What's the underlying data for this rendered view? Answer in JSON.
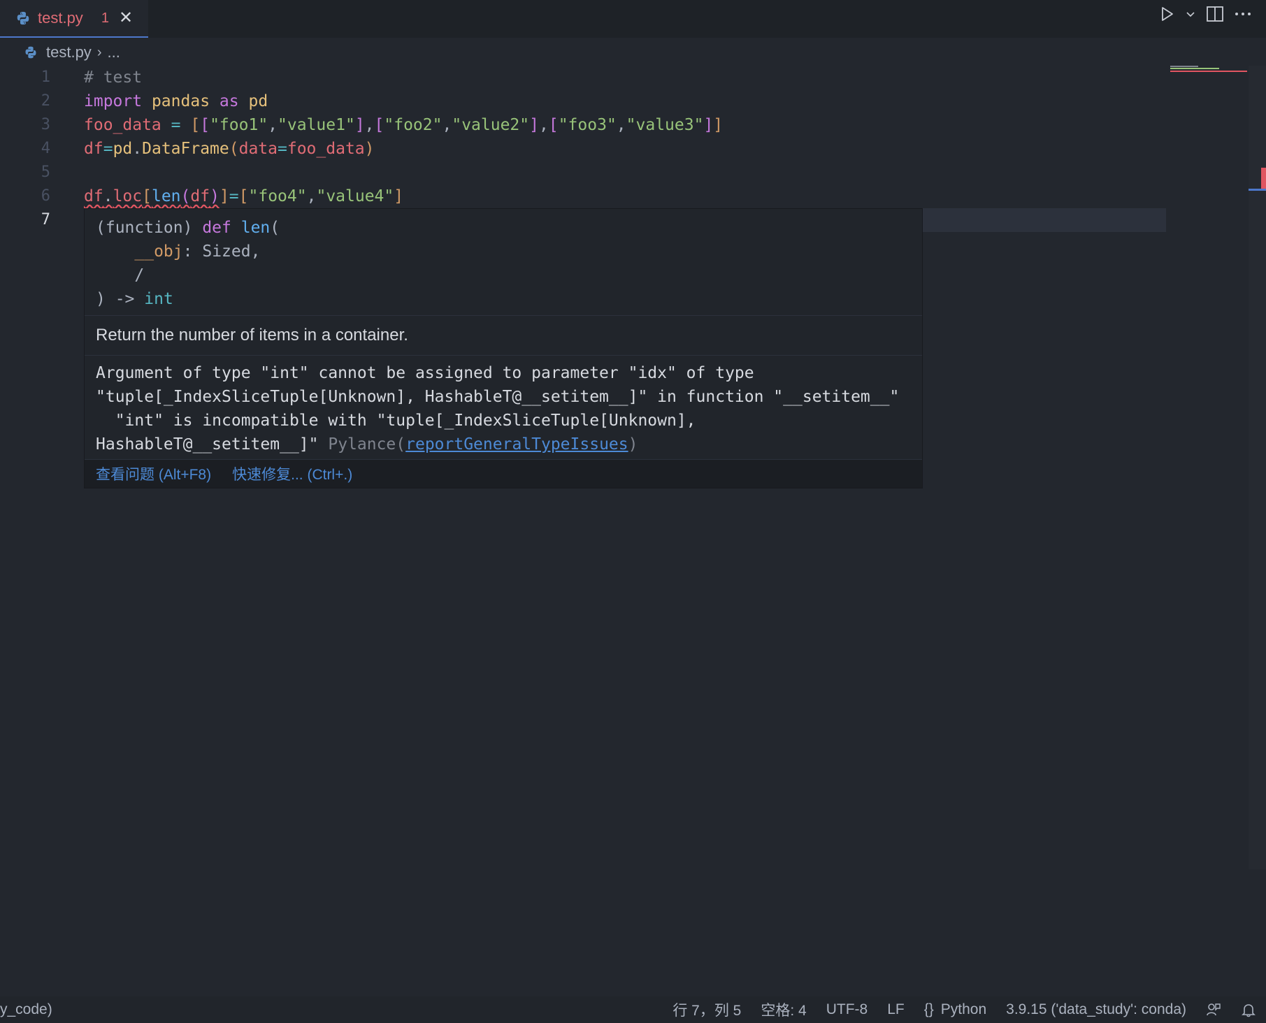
{
  "tab": {
    "filename": "test.py",
    "problem_count": "1",
    "close_glyph": "✕"
  },
  "breadcrumb": {
    "file": "test.py",
    "separator": "›",
    "more": "..."
  },
  "editor": {
    "line_numbers": [
      "1",
      "2",
      "3",
      "4",
      "5",
      "6",
      "7"
    ],
    "active_line": "7"
  },
  "hover": {
    "signature": {
      "prefix": "(function) ",
      "def_kw": "def",
      "fn_name": "len",
      "open": "(",
      "param": "__obj",
      "param_type": "Sized",
      "slash": "/",
      "close": ") -> ",
      "return_type": "int"
    },
    "description": "Return the number of items in a container.",
    "error_line1": "Argument of type \"int\" cannot be assigned to parameter \"idx\" of type",
    "error_line2": "\"tuple[_IndexSliceTuple[Unknown], HashableT@__setitem__]\" in function \"__setitem__\"",
    "error_line3": "  \"int\" is incompatible with \"tuple[_IndexSliceTuple[Unknown],",
    "error_line4": "HashableT@__setitem__]\" ",
    "error_source": "Pylance(",
    "error_code": "reportGeneralTypeIssues",
    "error_close": ")",
    "action_view_problem": "查看问题 (Alt+F8)",
    "action_quick_fix": "快速修复... (Ctrl+.)"
  },
  "statusbar": {
    "left_text": "y_code)",
    "position": "行 7，列 5",
    "indent": "空格: 4",
    "encoding": "UTF-8",
    "eol": "LF",
    "language_glyph": "{}",
    "language": "Python",
    "interpreter": "3.9.15 ('data_study': conda)"
  },
  "colors": {
    "accent": "#4d78cc",
    "error": "#e05561",
    "background": "#23272e"
  }
}
